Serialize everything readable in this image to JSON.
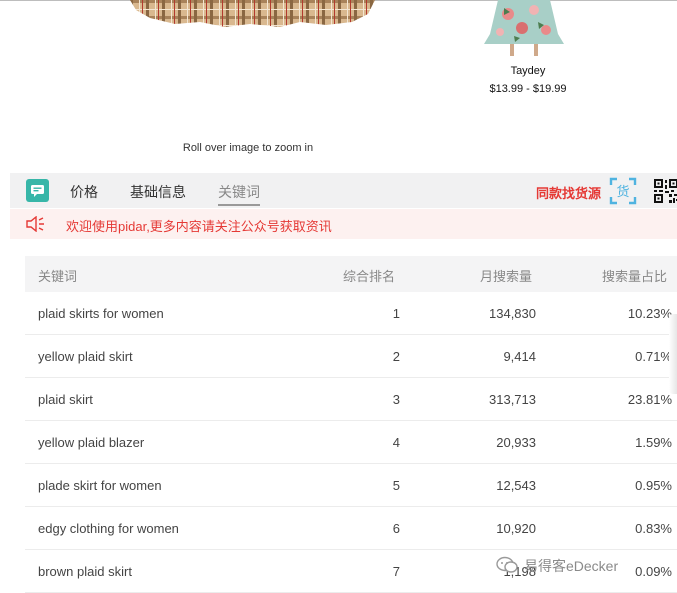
{
  "product": {
    "name": "Taydey",
    "price": "$13.99 - $19.99",
    "zoom_hint": "Roll over image to zoom in"
  },
  "toolbar": {
    "tabs": [
      {
        "label": "价格"
      },
      {
        "label": "基础信息"
      },
      {
        "label": "关键词"
      }
    ],
    "find_supply_label": "同款找货源",
    "scan_icon_text": "货"
  },
  "notice": {
    "text": "欢迎使用pidar,更多内容请关注公众号获取资讯"
  },
  "table": {
    "headers": {
      "keyword": "关键词",
      "rank": "综合排名",
      "volume": "月搜索量",
      "share": "搜索量占比"
    },
    "rows": [
      {
        "keyword": "plaid skirts for women",
        "rank": "1",
        "volume": "134,830",
        "share": "10.23%"
      },
      {
        "keyword": "yellow plaid skirt",
        "rank": "2",
        "volume": "9,414",
        "share": "0.71%"
      },
      {
        "keyword": "plaid skirt",
        "rank": "3",
        "volume": "313,713",
        "share": "23.81%"
      },
      {
        "keyword": "yellow plaid blazer",
        "rank": "4",
        "volume": "20,933",
        "share": "1.59%"
      },
      {
        "keyword": "plade skirt for women",
        "rank": "5",
        "volume": "12,543",
        "share": "0.95%"
      },
      {
        "keyword": "edgy clothing for women",
        "rank": "6",
        "volume": "10,920",
        "share": "0.83%"
      },
      {
        "keyword": "brown plaid skirt",
        "rank": "7",
        "volume": "1,198",
        "share": "0.09%"
      }
    ]
  },
  "watermark": {
    "text": "易得客eDecker"
  },
  "colors": {
    "accent_red": "#e53935",
    "logo_teal": "#37b6a8",
    "scan_blue": "#4fb3e0"
  }
}
